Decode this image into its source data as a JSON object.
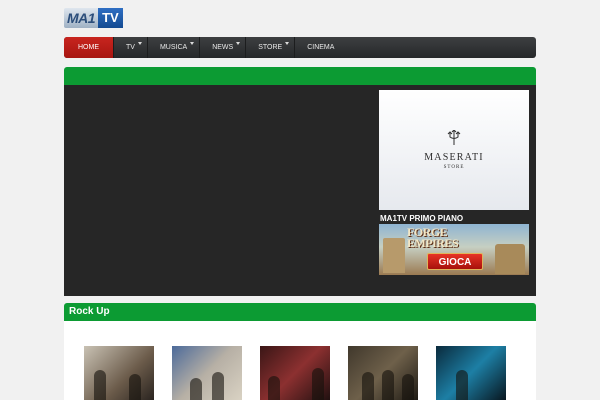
{
  "logo": {
    "part1": "MA1",
    "part2": "TV"
  },
  "nav": {
    "items": [
      {
        "label": "Home",
        "active": true,
        "dropdown": false
      },
      {
        "label": "TV",
        "active": false,
        "dropdown": true
      },
      {
        "label": "Musica",
        "active": false,
        "dropdown": true
      },
      {
        "label": "News",
        "active": false,
        "dropdown": true
      },
      {
        "label": "Store",
        "active": false,
        "dropdown": true
      },
      {
        "label": "Cinema",
        "active": false,
        "dropdown": false
      }
    ]
  },
  "ads": {
    "maserati": {
      "brand": "MASERATI",
      "sub": "STORE",
      "icon": "trident-icon"
    },
    "game": {
      "title_line1": "FORGE",
      "title_line2": "EMPIRES",
      "button": "GIOCA"
    }
  },
  "sidebar": {
    "section_label": "MA1TV PRIMO PIANO"
  },
  "rock": {
    "title": "Rock Up",
    "thumbnails": [
      {
        "kind": "video-thumbnail"
      },
      {
        "kind": "video-thumbnail"
      },
      {
        "kind": "video-thumbnail"
      },
      {
        "kind": "video-thumbnail"
      },
      {
        "kind": "video-thumbnail"
      }
    ]
  },
  "colors": {
    "accent_green": "#0c9b33",
    "nav_dark": "#2e3032",
    "active_red": "#c8251f",
    "panel_dark": "#262626",
    "page_bg": "#f1f1f1"
  }
}
